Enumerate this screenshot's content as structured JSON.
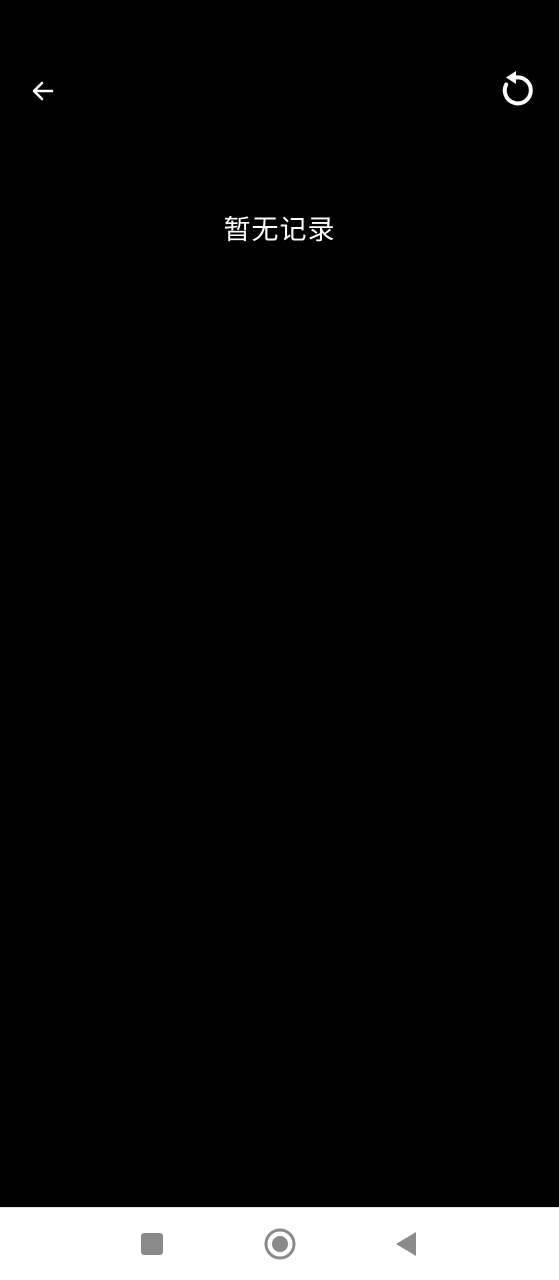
{
  "header": {
    "back_icon": "arrow-left-icon",
    "refresh_icon": "refresh-icon"
  },
  "main": {
    "empty_message": "暂无记录"
  },
  "system_nav": {
    "recents_icon": "square-icon",
    "home_icon": "circle-icon",
    "back_icon": "triangle-back-icon"
  },
  "colors": {
    "background": "#000000",
    "foreground": "#ffffff",
    "nav_background": "#ffffff",
    "nav_icon": "#8a8a8a"
  }
}
